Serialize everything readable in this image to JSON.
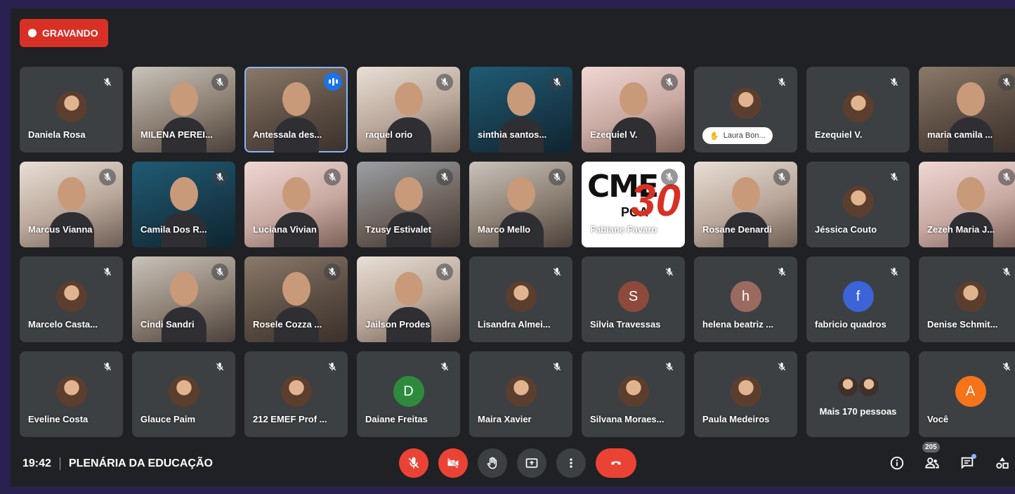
{
  "recording": {
    "label": "GRAVANDO"
  },
  "meeting": {
    "time": "19:42",
    "title": "PLENÁRIA DA EDUCAÇÃO"
  },
  "people_count": "205",
  "participants": [
    {
      "name": "Daniela Rosa",
      "type": "avatar"
    },
    {
      "name": "MILENA PEREI...",
      "type": "video"
    },
    {
      "name": "Antessala des...",
      "type": "video",
      "speaking": true
    },
    {
      "name": "raquel orio",
      "type": "video"
    },
    {
      "name": "sinthia santos...",
      "type": "video"
    },
    {
      "name": "Ezequiel V.",
      "type": "video"
    },
    {
      "name": "Laura Bon...",
      "type": "pill"
    },
    {
      "name": "Ezequiel V.",
      "type": "avatar"
    },
    {
      "name": "maria camila ...",
      "type": "video"
    },
    {
      "name": "Marcus Vianna",
      "type": "video"
    },
    {
      "name": "Camila Dos R...",
      "type": "video"
    },
    {
      "name": "Luciana Vivian",
      "type": "video"
    },
    {
      "name": "Tzusy Estivalet",
      "type": "video"
    },
    {
      "name": "Marco Mello",
      "type": "video"
    },
    {
      "name": "Fabiane Favaro",
      "type": "logo"
    },
    {
      "name": "Rosane Denardi",
      "type": "video"
    },
    {
      "name": "Jéssica Couto",
      "type": "avatar"
    },
    {
      "name": "Zezeh Maria J...",
      "type": "video"
    },
    {
      "name": "Marcelo Casta...",
      "type": "avatar"
    },
    {
      "name": "Cindi Sandri",
      "type": "video"
    },
    {
      "name": "Rosele Cozza ...",
      "type": "video"
    },
    {
      "name": "Jailson Prodes",
      "type": "video"
    },
    {
      "name": "Lisandra Almei...",
      "type": "avatar"
    },
    {
      "name": "Silvia Travessas",
      "type": "letter",
      "letter": "S",
      "color": "#8d4a3a"
    },
    {
      "name": "helena beatriz ...",
      "type": "letter",
      "letter": "h",
      "color": "#9b6a5e"
    },
    {
      "name": "fabricio quadros",
      "type": "letter",
      "letter": "f",
      "color": "#3d63d8"
    },
    {
      "name": "Denise Schmit...",
      "type": "avatar"
    },
    {
      "name": "Eveline Costa",
      "type": "avatar"
    },
    {
      "name": "Glauce Paim",
      "type": "avatar"
    },
    {
      "name": "212 EMEF Prof ...",
      "type": "avatar"
    },
    {
      "name": "Daiane Freitas",
      "type": "letter",
      "letter": "D",
      "color": "#2e8b3d"
    },
    {
      "name": "Maira Xavier",
      "type": "avatar"
    },
    {
      "name": "Silvana Moraes...",
      "type": "avatar"
    },
    {
      "name": "Paula Medeiros",
      "type": "avatar"
    },
    {
      "name": "Mais 170 pessoas",
      "type": "more"
    },
    {
      "name": "Você",
      "type": "letter",
      "letter": "A",
      "color": "#f6731a"
    }
  ],
  "logo_text": {
    "main": "CME",
    "city": "POA",
    "number": "30"
  },
  "colors": {
    "recording": "#d93025",
    "end_call": "#ea4335",
    "speaking": "#1a73e8"
  }
}
